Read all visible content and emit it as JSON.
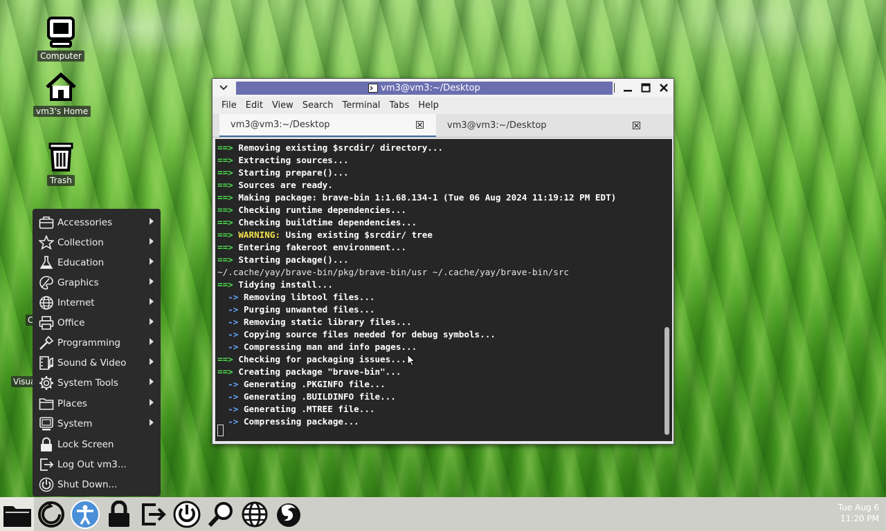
{
  "desktop": {
    "icons": [
      {
        "label": "Computer"
      },
      {
        "label": "vm3's Home"
      },
      {
        "label": "Trash"
      }
    ],
    "hidden_labels": [
      "C",
      "Visua"
    ]
  },
  "terminal_window": {
    "title": "vm3@vm3:~/Desktop",
    "menu": [
      "File",
      "Edit",
      "View",
      "Search",
      "Terminal",
      "Tabs",
      "Help"
    ],
    "tabs": [
      {
        "label": "vm3@vm3:~/Desktop",
        "active": true
      },
      {
        "label": "vm3@vm3:~/Desktop",
        "active": false
      }
    ],
    "lines": [
      {
        "prefix": "==>",
        "kind": "arrow",
        "text": "Removing existing $srcdir/ directory..."
      },
      {
        "prefix": "==>",
        "kind": "arrow",
        "text": "Extracting sources..."
      },
      {
        "prefix": "==>",
        "kind": "arrow",
        "text": "Starting prepare()..."
      },
      {
        "prefix": "==>",
        "kind": "arrow",
        "text": "Sources are ready."
      },
      {
        "prefix": "==>",
        "kind": "arrow",
        "text": "Making package: brave-bin 1:1.68.134-1 (Tue 06 Aug 2024 11:19:12 PM EDT)"
      },
      {
        "prefix": "==>",
        "kind": "arrow",
        "text": "Checking runtime dependencies..."
      },
      {
        "prefix": "==>",
        "kind": "arrow",
        "text": "Checking buildtime dependencies..."
      },
      {
        "prefix": "==>",
        "kind": "warn",
        "warn": "WARNING:",
        "text": "Using existing $srcdir/ tree"
      },
      {
        "prefix": "==>",
        "kind": "arrow",
        "text": "Entering fakeroot environment..."
      },
      {
        "prefix": "==>",
        "kind": "arrow",
        "text": "Starting package()..."
      },
      {
        "prefix": "",
        "kind": "plain",
        "text": "~/.cache/yay/brave-bin/pkg/brave-bin/usr ~/.cache/yay/brave-bin/src"
      },
      {
        "prefix": "==>",
        "kind": "arrow",
        "text": "Tidying install..."
      },
      {
        "prefix": "  ->",
        "kind": "sub",
        "text": "Removing libtool files..."
      },
      {
        "prefix": "  ->",
        "kind": "sub",
        "text": "Purging unwanted files..."
      },
      {
        "prefix": "  ->",
        "kind": "sub",
        "text": "Removing static library files..."
      },
      {
        "prefix": "  ->",
        "kind": "sub",
        "text": "Copying source files needed for debug symbols..."
      },
      {
        "prefix": "  ->",
        "kind": "sub",
        "text": "Compressing man and info pages..."
      },
      {
        "prefix": "==>",
        "kind": "arrow",
        "text": "Checking for packaging issues..."
      },
      {
        "prefix": "==>",
        "kind": "arrow",
        "text": "Creating package \"brave-bin\"..."
      },
      {
        "prefix": "  ->",
        "kind": "sub",
        "text": "Generating .PKGINFO file..."
      },
      {
        "prefix": "  ->",
        "kind": "sub",
        "text": "Generating .BUILDINFO file..."
      },
      {
        "prefix": "  ->",
        "kind": "sub",
        "text": "Generating .MTREE file..."
      },
      {
        "prefix": "  ->",
        "kind": "sub",
        "text": "Compressing package..."
      }
    ]
  },
  "app_menu": {
    "items": [
      {
        "label": "Accessories",
        "icon": "toolbox-icon",
        "submenu": true
      },
      {
        "label": "Collection",
        "icon": "star-icon",
        "submenu": true
      },
      {
        "label": "Education",
        "icon": "flask-icon",
        "submenu": true
      },
      {
        "label": "Graphics",
        "icon": "palette-icon",
        "submenu": true
      },
      {
        "label": "Internet",
        "icon": "globe-icon",
        "submenu": true
      },
      {
        "label": "Office",
        "icon": "printer-icon",
        "submenu": true
      },
      {
        "label": "Programming",
        "icon": "wand-icon",
        "submenu": true
      },
      {
        "label": "Sound & Video",
        "icon": "film-icon",
        "submenu": true
      },
      {
        "label": "System Tools",
        "icon": "gear-icon",
        "submenu": true
      },
      {
        "label": "Places",
        "icon": "folder-icon",
        "submenu": true
      },
      {
        "label": "System",
        "icon": "monitor-icon",
        "submenu": true
      },
      {
        "label": "Lock Screen",
        "icon": "lock-icon",
        "submenu": false
      },
      {
        "label": "Log Out vm3...",
        "icon": "logout-icon",
        "submenu": false
      },
      {
        "label": "Shut Down...",
        "icon": "power-icon",
        "submenu": false
      }
    ]
  },
  "taskbar": {
    "launchers": [
      "files-icon",
      "refresh-icon",
      "accessibility-icon",
      "lock-icon",
      "logout-icon",
      "power-icon",
      "search-icon",
      "globe-icon",
      "firefox-icon"
    ],
    "clock": {
      "date": "Tue Aug  6",
      "time": "11:20 PM"
    }
  }
}
